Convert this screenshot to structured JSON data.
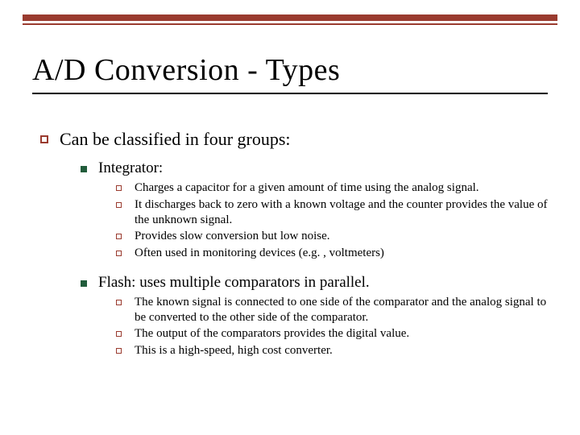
{
  "slide": {
    "title": "A/D Conversion - Types",
    "level1": {
      "text": "Can be classified in four groups:"
    },
    "sections": [
      {
        "heading": "Integrator:",
        "items": [
          "Charges a capacitor for a given amount of time using the analog signal.",
          "It discharges back to zero with a known voltage and the counter provides the value of the unknown signal.",
          "Provides slow conversion but low noise.",
          "Often used in monitoring devices (e.g. , voltmeters)"
        ]
      },
      {
        "heading": "Flash: uses multiple comparators in parallel.",
        "items": [
          "The known signal is connected to one side of the comparator and the analog signal to be converted to the other side of the comparator.",
          "The output of the comparators provides the digital value.",
          "This is a high-speed, high cost converter."
        ]
      }
    ]
  }
}
